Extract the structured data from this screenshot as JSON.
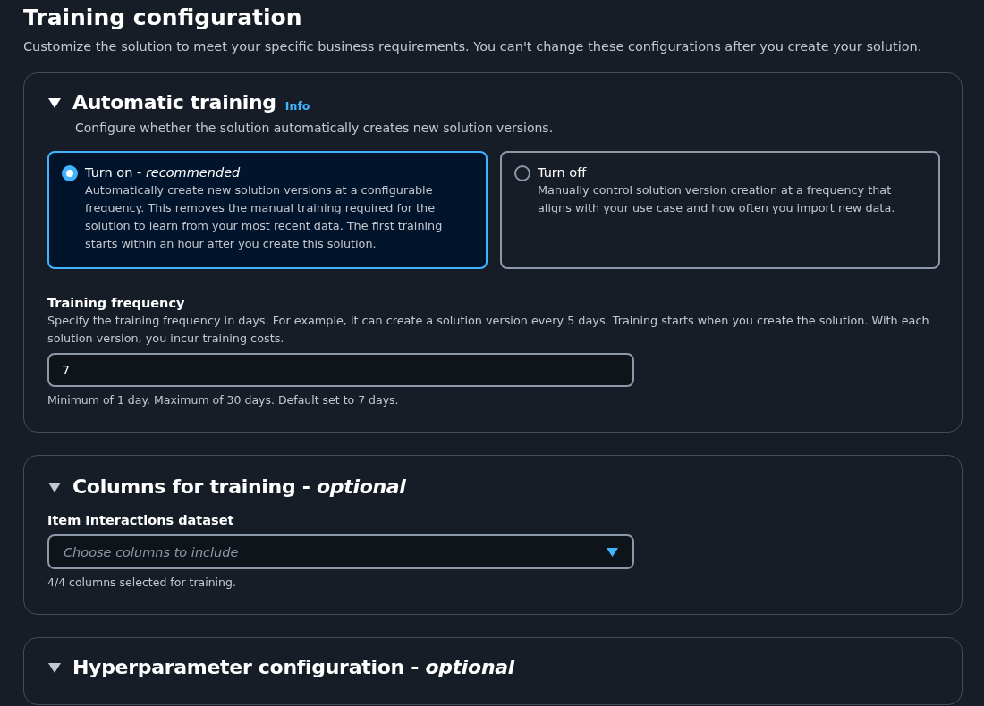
{
  "page": {
    "title": "Training configuration",
    "description": "Customize the solution to meet your specific business requirements. You can't change these configurations after you create your solution."
  },
  "sections": [
    {
      "kind": "automatic",
      "title": "Automatic training",
      "expanded": true,
      "info": "Info",
      "description": "Configure whether the solution automatically creates new solution versions.",
      "options": [
        {
          "label": "Turn on - *recommended*",
          "description": "Automatically create new solution versions at a configurable frequency. This removes the manual training required for the solution to learn from your most recent data. The first training starts within an hour after you create this solution.",
          "selected": true
        },
        {
          "label": "Turn off",
          "description": "Manually control solution version creation at a frequency that aligns with your use case and how often you import new data.",
          "selected": false
        }
      ],
      "field": {
        "label": "Training frequency",
        "description": "Specify the training frequency in days. For example, it can create a solution version every 5 days. Training starts when you create the solution. With each solution version, you incur training costs.",
        "value": "7",
        "hint": "Minimum of 1 day. Maximum of 30 days. Default set to 7 days."
      }
    },
    {
      "kind": "columns",
      "title": "Columns for training - *optional*",
      "expanded": true,
      "field": {
        "label": "Item Interactions dataset",
        "placeholder": "Choose columns to include",
        "hint": "4/4 columns selected for training."
      }
    },
    {
      "kind": "hyperparameters",
      "title": "Hyperparameter configuration - *optional*",
      "expanded": true
    }
  ]
}
